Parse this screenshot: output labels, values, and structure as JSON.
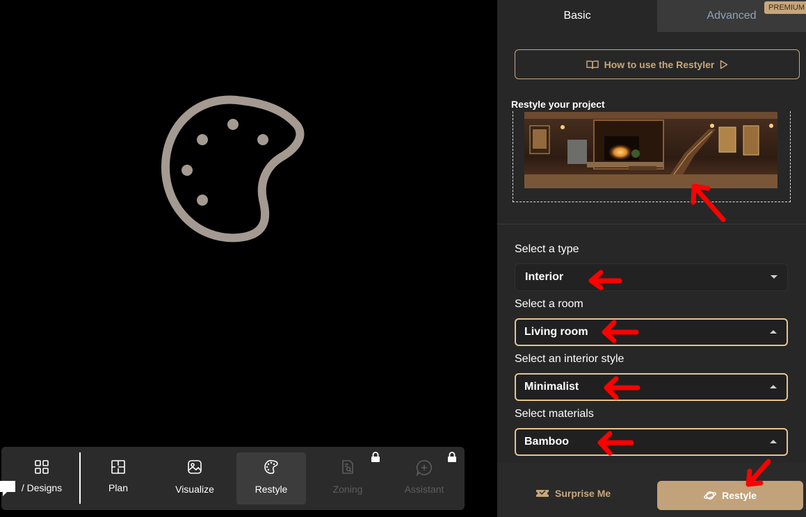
{
  "panel": {
    "tabs": [
      {
        "label": "Basic",
        "active": true
      },
      {
        "label": "Advanced",
        "active": false,
        "badge": "PREMIUM"
      }
    ],
    "howto_label": "How to use the Restyler",
    "restyle_title": "Restyle your project",
    "fields": [
      {
        "label": "Select a type",
        "value": "Interior",
        "open": false
      },
      {
        "label": "Select a room",
        "value": "Living room",
        "open": true
      },
      {
        "label": "Select an interior style",
        "value": "Minimalist",
        "open": true
      },
      {
        "label": "Select materials",
        "value": "Bamboo",
        "open": true
      }
    ],
    "surprise_label": "Surprise Me",
    "restyle_label": "Restyle"
  },
  "toolbar": {
    "items": [
      {
        "label": "/ Designs",
        "icon": "grid-icon",
        "state": "normal"
      },
      {
        "label": "Plan",
        "icon": "floorplan-icon",
        "state": "normal"
      },
      {
        "label": "Visualize",
        "icon": "image-icon",
        "state": "normal"
      },
      {
        "label": "Restyle",
        "icon": "palette-icon",
        "state": "active"
      },
      {
        "label": "Zoning",
        "icon": "document-search-icon",
        "state": "locked"
      },
      {
        "label": "Assistant",
        "icon": "chat-plus-icon",
        "state": "locked"
      }
    ]
  },
  "colors": {
    "accent_gold": "#c8a77c",
    "panel_bg": "#272727",
    "annotation_red": "#ff0000"
  }
}
